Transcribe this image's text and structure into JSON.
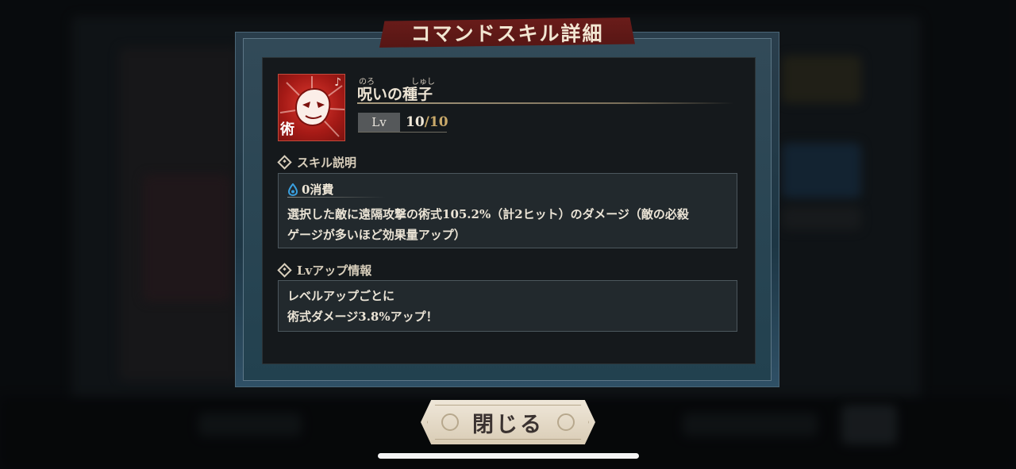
{
  "dialog": {
    "title": "コマンドスキル詳細"
  },
  "skill": {
    "icon_name": "mask-skill-icon",
    "icon_kanji": "術",
    "cost_mark_symbol": "♪",
    "name": "呪いの種子",
    "ruby_noro": "のろ",
    "ruby_shushi": "しゅし",
    "level_label": "Lv",
    "level_current": "10",
    "level_separator": "/",
    "level_max": "10"
  },
  "description_section": {
    "heading": "スキル説明",
    "cost_text": "0消費",
    "cost_icon": "drop-icon",
    "text_line1": "選択した敵に遠隔攻撃の術式105.2%（計2ヒット）のダメージ（敵の必殺",
    "text_line2": "ゲージが多いほど効果量アップ）"
  },
  "levelup_section": {
    "heading": "Lvアップ情報",
    "text_line1": "レベルアップごとに",
    "text_line2": "術式ダメージ3.8%アップ！"
  },
  "footer": {
    "close_label": "閉じる"
  },
  "colors": {
    "title_ribbon": "#5e1816",
    "icon_red": "#c8241c",
    "level_max_gold": "#c9a96a",
    "panel_bg": "#15191c",
    "cost_drop_blue": "#3aa0e0"
  }
}
